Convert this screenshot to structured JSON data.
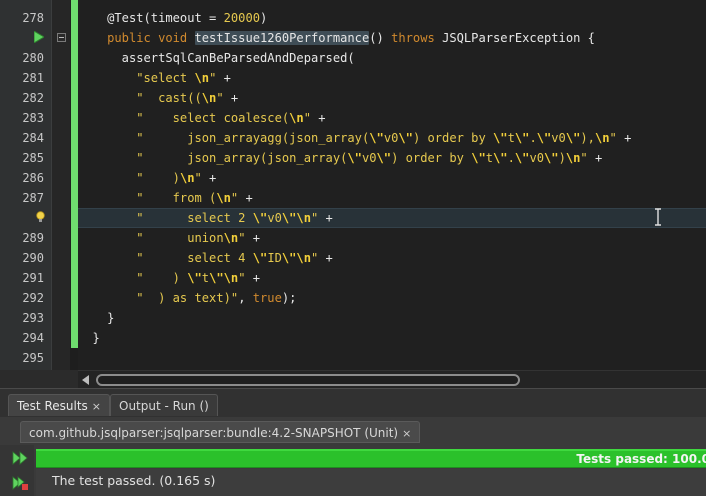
{
  "editor": {
    "lines": [
      {
        "num": "278",
        "tokens": [
          {
            "t": "    ",
            "c": "plain"
          },
          {
            "t": "@Test(timeout = ",
            "c": "plain"
          },
          {
            "t": "20000",
            "c": "num"
          },
          {
            "t": ")",
            "c": "plain"
          }
        ]
      },
      {
        "num": "",
        "tokens": [
          {
            "t": "    ",
            "c": "plain"
          },
          {
            "t": "public void ",
            "c": "kw"
          },
          {
            "t": "testIssue1260Performance",
            "c": "hl"
          },
          {
            "t": "() ",
            "c": "plain"
          },
          {
            "t": "throws ",
            "c": "kw"
          },
          {
            "t": "JSQLParserException {",
            "c": "plain"
          }
        ]
      },
      {
        "num": "280",
        "tokens": [
          {
            "t": "      assertSqlCanBeParsedAndDeparsed(",
            "c": "plain"
          }
        ]
      },
      {
        "num": "281",
        "tokens": [
          {
            "t": "        ",
            "c": "plain"
          },
          {
            "t": "\"select ",
            "c": "str"
          },
          {
            "t": "\\n",
            "c": "esc"
          },
          {
            "t": "\"",
            "c": "str"
          },
          {
            "t": " +",
            "c": "plain"
          }
        ]
      },
      {
        "num": "282",
        "tokens": [
          {
            "t": "        ",
            "c": "plain"
          },
          {
            "t": "\"  cast((",
            "c": "str"
          },
          {
            "t": "\\n",
            "c": "esc"
          },
          {
            "t": "\"",
            "c": "str"
          },
          {
            "t": " +",
            "c": "plain"
          }
        ]
      },
      {
        "num": "283",
        "tokens": [
          {
            "t": "        ",
            "c": "plain"
          },
          {
            "t": "\"    select coalesce(",
            "c": "str"
          },
          {
            "t": "\\n",
            "c": "esc"
          },
          {
            "t": "\"",
            "c": "str"
          },
          {
            "t": " +",
            "c": "plain"
          }
        ]
      },
      {
        "num": "284",
        "tokens": [
          {
            "t": "        ",
            "c": "plain"
          },
          {
            "t": "\"      json_arrayagg(json_array(",
            "c": "str"
          },
          {
            "t": "\\\"",
            "c": "esc"
          },
          {
            "t": "v0",
            "c": "str"
          },
          {
            "t": "\\\"",
            "c": "esc"
          },
          {
            "t": ") order by ",
            "c": "str"
          },
          {
            "t": "\\\"",
            "c": "esc"
          },
          {
            "t": "t",
            "c": "str"
          },
          {
            "t": "\\\"",
            "c": "esc"
          },
          {
            "t": ".",
            "c": "str"
          },
          {
            "t": "\\\"",
            "c": "esc"
          },
          {
            "t": "v0",
            "c": "str"
          },
          {
            "t": "\\\"",
            "c": "esc"
          },
          {
            "t": "),",
            "c": "str"
          },
          {
            "t": "\\n",
            "c": "esc"
          },
          {
            "t": "\"",
            "c": "str"
          },
          {
            "t": " +",
            "c": "plain"
          }
        ]
      },
      {
        "num": "285",
        "tokens": [
          {
            "t": "        ",
            "c": "plain"
          },
          {
            "t": "\"      json_array(json_array(",
            "c": "str"
          },
          {
            "t": "\\\"",
            "c": "esc"
          },
          {
            "t": "v0",
            "c": "str"
          },
          {
            "t": "\\\"",
            "c": "esc"
          },
          {
            "t": ") order by ",
            "c": "str"
          },
          {
            "t": "\\\"",
            "c": "esc"
          },
          {
            "t": "t",
            "c": "str"
          },
          {
            "t": "\\\"",
            "c": "esc"
          },
          {
            "t": ".",
            "c": "str"
          },
          {
            "t": "\\\"",
            "c": "esc"
          },
          {
            "t": "v0",
            "c": "str"
          },
          {
            "t": "\\\"",
            "c": "esc"
          },
          {
            "t": ")",
            "c": "str"
          },
          {
            "t": "\\n",
            "c": "esc"
          },
          {
            "t": "\"",
            "c": "str"
          },
          {
            "t": " +",
            "c": "plain"
          }
        ]
      },
      {
        "num": "286",
        "tokens": [
          {
            "t": "        ",
            "c": "plain"
          },
          {
            "t": "\"    )",
            "c": "str"
          },
          {
            "t": "\\n",
            "c": "esc"
          },
          {
            "t": "\"",
            "c": "str"
          },
          {
            "t": " +",
            "c": "plain"
          }
        ]
      },
      {
        "num": "287",
        "tokens": [
          {
            "t": "        ",
            "c": "plain"
          },
          {
            "t": "\"    from (",
            "c": "str"
          },
          {
            "t": "\\n",
            "c": "esc"
          },
          {
            "t": "\"",
            "c": "str"
          },
          {
            "t": " +",
            "c": "plain"
          }
        ]
      },
      {
        "num": "",
        "tokens": [
          {
            "t": "        ",
            "c": "plain"
          },
          {
            "t": "\"      select 2 ",
            "c": "str"
          },
          {
            "t": "\\\"",
            "c": "esc"
          },
          {
            "t": "v0",
            "c": "str"
          },
          {
            "t": "\\\"\\n",
            "c": "esc"
          },
          {
            "t": "\"",
            "c": "str"
          },
          {
            "t": " +",
            "c": "plain"
          }
        ]
      },
      {
        "num": "289",
        "tokens": [
          {
            "t": "        ",
            "c": "plain"
          },
          {
            "t": "\"      union",
            "c": "str"
          },
          {
            "t": "\\n",
            "c": "esc"
          },
          {
            "t": "\"",
            "c": "str"
          },
          {
            "t": " +",
            "c": "plain"
          }
        ]
      },
      {
        "num": "290",
        "tokens": [
          {
            "t": "        ",
            "c": "plain"
          },
          {
            "t": "\"      select 4 ",
            "c": "str"
          },
          {
            "t": "\\\"",
            "c": "esc"
          },
          {
            "t": "ID",
            "c": "str"
          },
          {
            "t": "\\\"\\n",
            "c": "esc"
          },
          {
            "t": "\"",
            "c": "str"
          },
          {
            "t": " +",
            "c": "plain"
          }
        ]
      },
      {
        "num": "291",
        "tokens": [
          {
            "t": "        ",
            "c": "plain"
          },
          {
            "t": "\"    ) ",
            "c": "str"
          },
          {
            "t": "\\\"",
            "c": "esc"
          },
          {
            "t": "t",
            "c": "str"
          },
          {
            "t": "\\\"\\n",
            "c": "esc"
          },
          {
            "t": "\"",
            "c": "str"
          },
          {
            "t": " +",
            "c": "plain"
          }
        ]
      },
      {
        "num": "292",
        "tokens": [
          {
            "t": "        ",
            "c": "plain"
          },
          {
            "t": "\"  ) as text)\"",
            "c": "str"
          },
          {
            "t": ", ",
            "c": "plain"
          },
          {
            "t": "true",
            "c": "kw"
          },
          {
            "t": ");",
            "c": "plain"
          }
        ]
      },
      {
        "num": "293",
        "tokens": [
          {
            "t": "    }",
            "c": "plain"
          }
        ]
      },
      {
        "num": "294",
        "tokens": [
          {
            "t": "  }",
            "c": "plain"
          }
        ]
      },
      {
        "num": "295",
        "tokens": []
      }
    ]
  },
  "panel": {
    "tabs": [
      {
        "label": "Test Results",
        "close": "×",
        "active": true
      },
      {
        "label": "Output - Run ()",
        "close": "",
        "active": false
      }
    ],
    "test_tab": {
      "label": "com.github.jsqlparser:jsqlparser:bundle:4.2-SNAPSHOT (Unit)",
      "close": "×"
    },
    "progress_label": "Tests passed: 100.0",
    "result_message": "The test passed. (0.165 s)"
  },
  "icons": {
    "run": "run-test-icon",
    "fold": "fold-collapse-icon",
    "hint": "lightbulb-hint-icon",
    "rerun": "rerun-tests-icon",
    "rerun_failed": "rerun-failed-icon"
  },
  "colors": {
    "change_bar": "#6fdc6f",
    "progress": "#2bc12b",
    "keyword": "#d18a2e",
    "string": "#e6c94f"
  }
}
